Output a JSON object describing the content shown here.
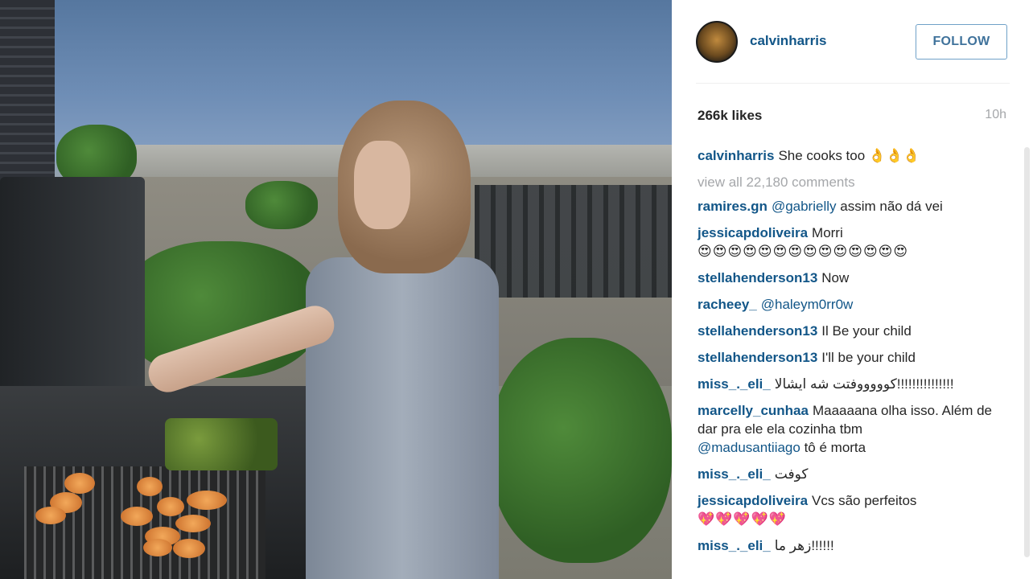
{
  "header": {
    "username": "calvinharris",
    "follow_label": "FOLLOW"
  },
  "post": {
    "likes": "266k likes",
    "time": "10h",
    "caption_user": "calvinharris",
    "caption_text": "She cooks too 👌👌👌",
    "view_all": "view all 22,180 comments"
  },
  "comments": [
    {
      "user": "ramires.gn",
      "mention": "@gabrielly",
      "text": "assim não dá vei"
    },
    {
      "user": "jessicapdoliveira",
      "text": "Morri",
      "text2": "😍😍😍😍😍😍😍😍😍😍😍😍😍😍"
    },
    {
      "user": "stellahenderson13",
      "text": "Now"
    },
    {
      "user": "racheey_",
      "mention": "@haleym0rr0w"
    },
    {
      "user": "stellahenderson13",
      "text": "Il Be your child"
    },
    {
      "user": "stellahenderson13",
      "text": "I'll be your child"
    },
    {
      "user": "miss_._eli_",
      "text": "كوووووفتت شه ايشالا!!!!!!!!!!!!!!!"
    },
    {
      "user": "marcelly_cunhaa",
      "text": "Maaaaana olha isso. Além de dar pra ele ela cozinha tbm",
      "mention2": "@madusantiiago",
      "text2": "tô é morta"
    },
    {
      "user": "miss_._eli_",
      "text": "كوفت"
    },
    {
      "user": "jessicapdoliveira",
      "text": "Vcs são perfeitos",
      "text2": "💖💖💖💖💖"
    },
    {
      "user": "miss_._eli_",
      "text": "زهر ما!!!!!!"
    }
  ]
}
